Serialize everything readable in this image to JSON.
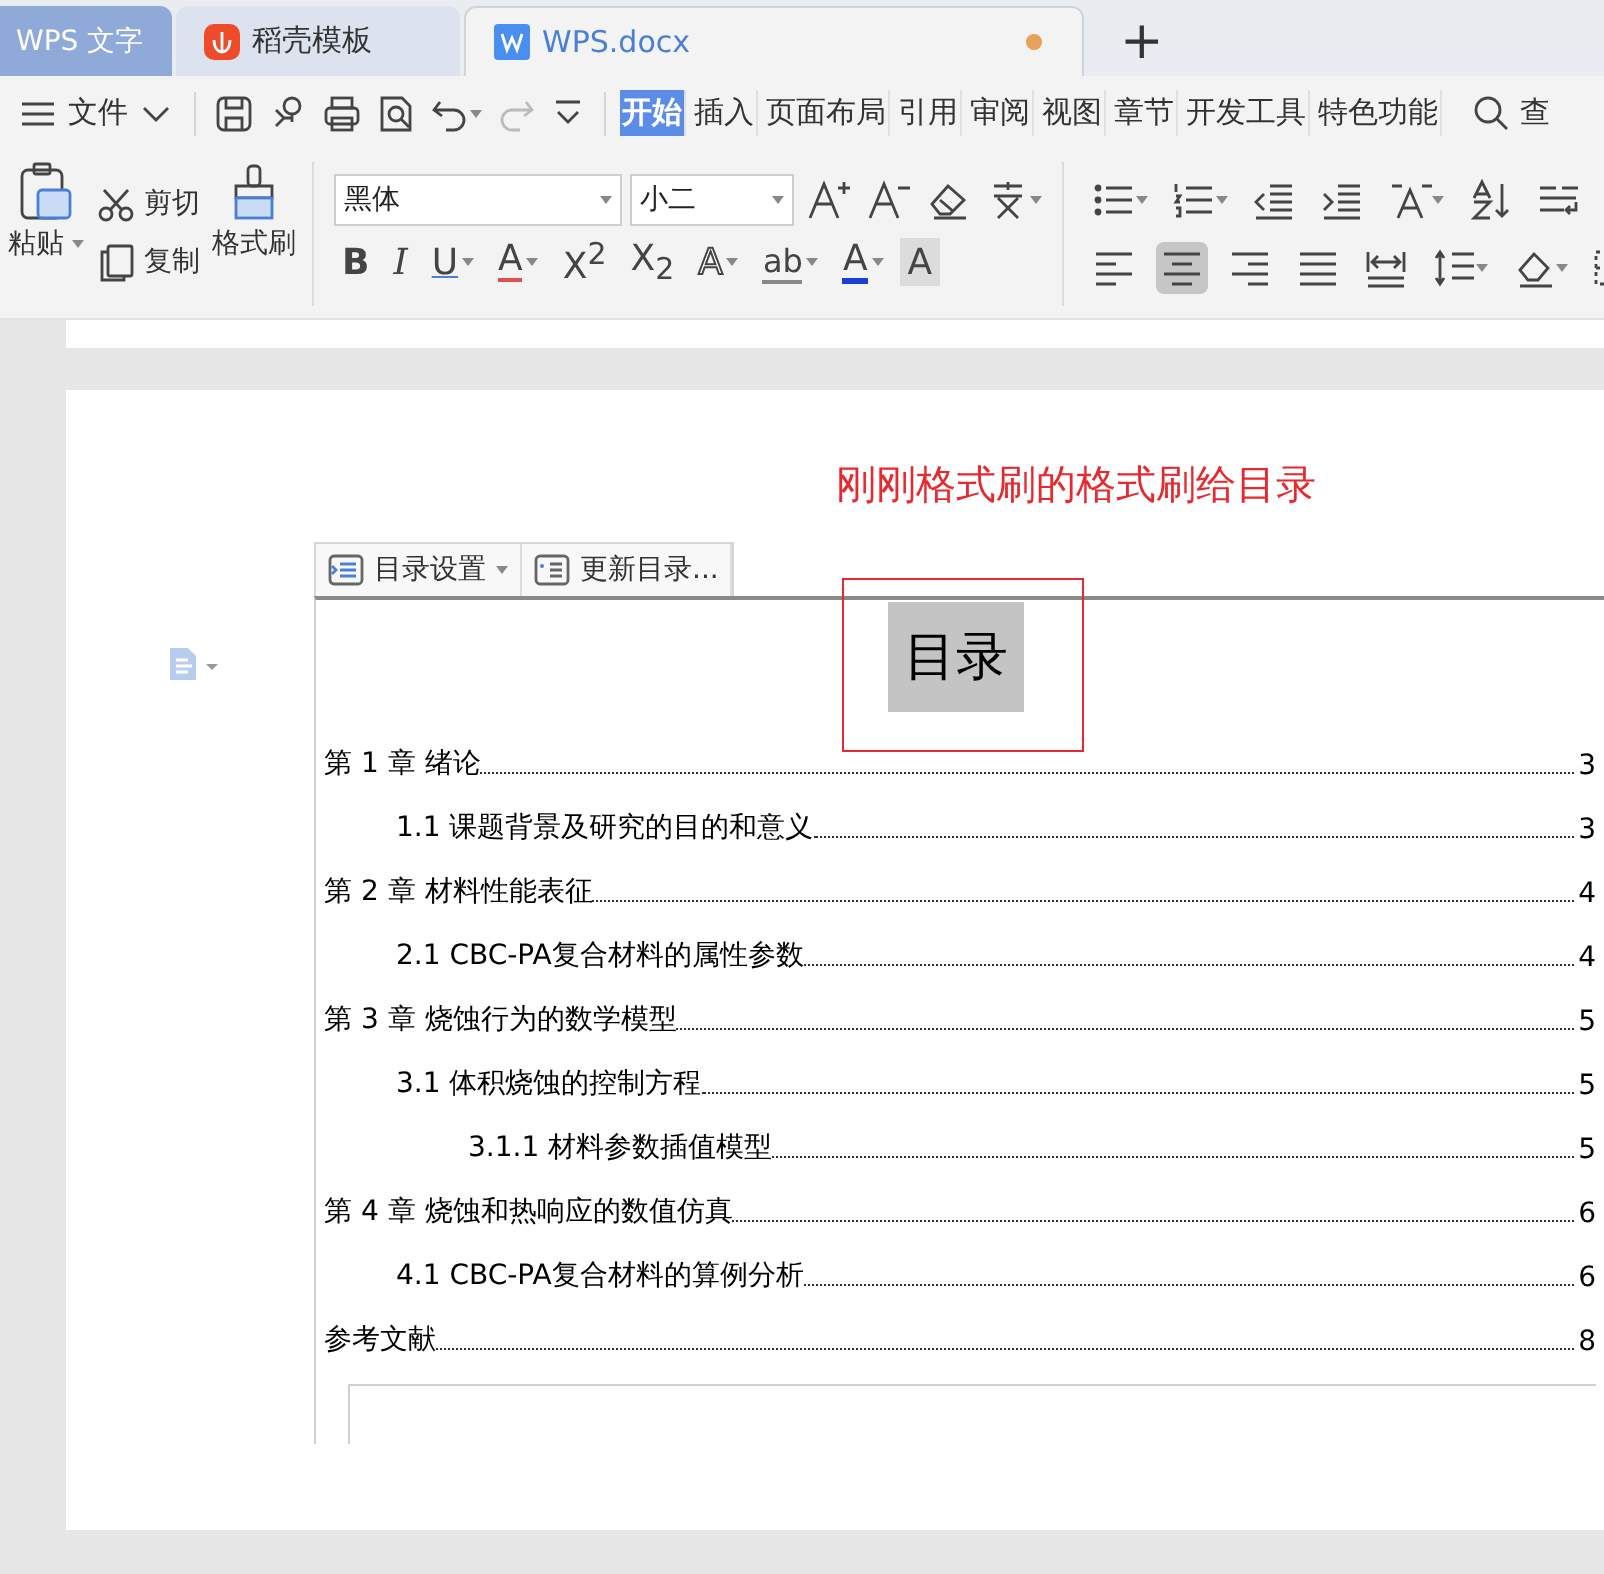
{
  "tabs": [
    {
      "label": "WPS 文字",
      "kind": "home",
      "selected": false
    },
    {
      "label": "稻壳模板",
      "kind": "template",
      "selected": false
    },
    {
      "label": "WPS.docx",
      "kind": "document",
      "selected": true,
      "unsaved": true
    }
  ],
  "new_tab": {
    "label": "+"
  },
  "file_menu": {
    "label": "文件"
  },
  "ribbon_tabs": [
    {
      "label": "开始",
      "selected": true
    },
    {
      "label": "插入",
      "selected": false
    },
    {
      "label": "页面布局",
      "selected": false
    },
    {
      "label": "引用",
      "selected": false
    },
    {
      "label": "审阅",
      "selected": false
    },
    {
      "label": "视图",
      "selected": false
    },
    {
      "label": "章节",
      "selected": false
    },
    {
      "label": "开发工具",
      "selected": false
    },
    {
      "label": "特色功能",
      "selected": false
    }
  ],
  "search": {
    "label": "查"
  },
  "clipboard": {
    "paste": "粘贴",
    "cut": "剪切",
    "copy": "复制",
    "format_painter": "格式刷"
  },
  "font": {
    "family": "黑体",
    "size": "小二",
    "buttons": [
      {
        "kind": "bold",
        "glyph": "B"
      },
      {
        "kind": "italic",
        "glyph": "I"
      },
      {
        "kind": "underline",
        "glyph": "U",
        "dropdown": true
      },
      {
        "kind": "strike",
        "glyph": "A",
        "dropdown": true
      },
      {
        "kind": "superscript",
        "glyph": "X$^{2}$"
      },
      {
        "kind": "subscript",
        "glyph": "X$_{2}$"
      },
      {
        "kind": "outline",
        "glyph": "A",
        "dropdown": true
      },
      {
        "kind": "highlight",
        "glyph": "ab",
        "dropdown": true
      },
      {
        "kind": "color",
        "glyph": "A",
        "dropdown": true
      },
      {
        "kind": "shade",
        "glyph": "A"
      }
    ]
  },
  "annotation": "刚刚格式刷的格式刷给目录",
  "toc_toolbar": [
    {
      "label": "目录设置",
      "dropdown": true
    },
    {
      "label": "更新目录...",
      "dropdown": false
    }
  ],
  "toc": {
    "title": "目录",
    "title_highlighted": true,
    "entries": [
      {
        "text": "第 1 章 绪论",
        "page": "3",
        "children": [
          {
            "text": "1.1 课题背景及研究的目的和意义",
            "page": "3"
          }
        ]
      },
      {
        "text": "第 2 章 材料性能表征",
        "page": "4",
        "children": [
          {
            "text": "2.1 CBC-PA复合材料的属性参数",
            "page": "4"
          }
        ]
      },
      {
        "text": "第 3 章 烧蚀行为的数学模型",
        "page": "5",
        "children": [
          {
            "text": "3.1 体积烧蚀的控制方程",
            "page": "5",
            "children": [
              {
                "text": "3.1.1 材料参数插值模型",
                "page": "5"
              }
            ]
          }
        ]
      },
      {
        "text": "第 4 章 烧蚀和热响应的数值仿真",
        "page": "6",
        "children": [
          {
            "text": "4.1 CBC-PA复合材料的算例分析",
            "page": "6"
          }
        ]
      },
      {
        "text": "参考文献",
        "page": "8"
      }
    ]
  }
}
